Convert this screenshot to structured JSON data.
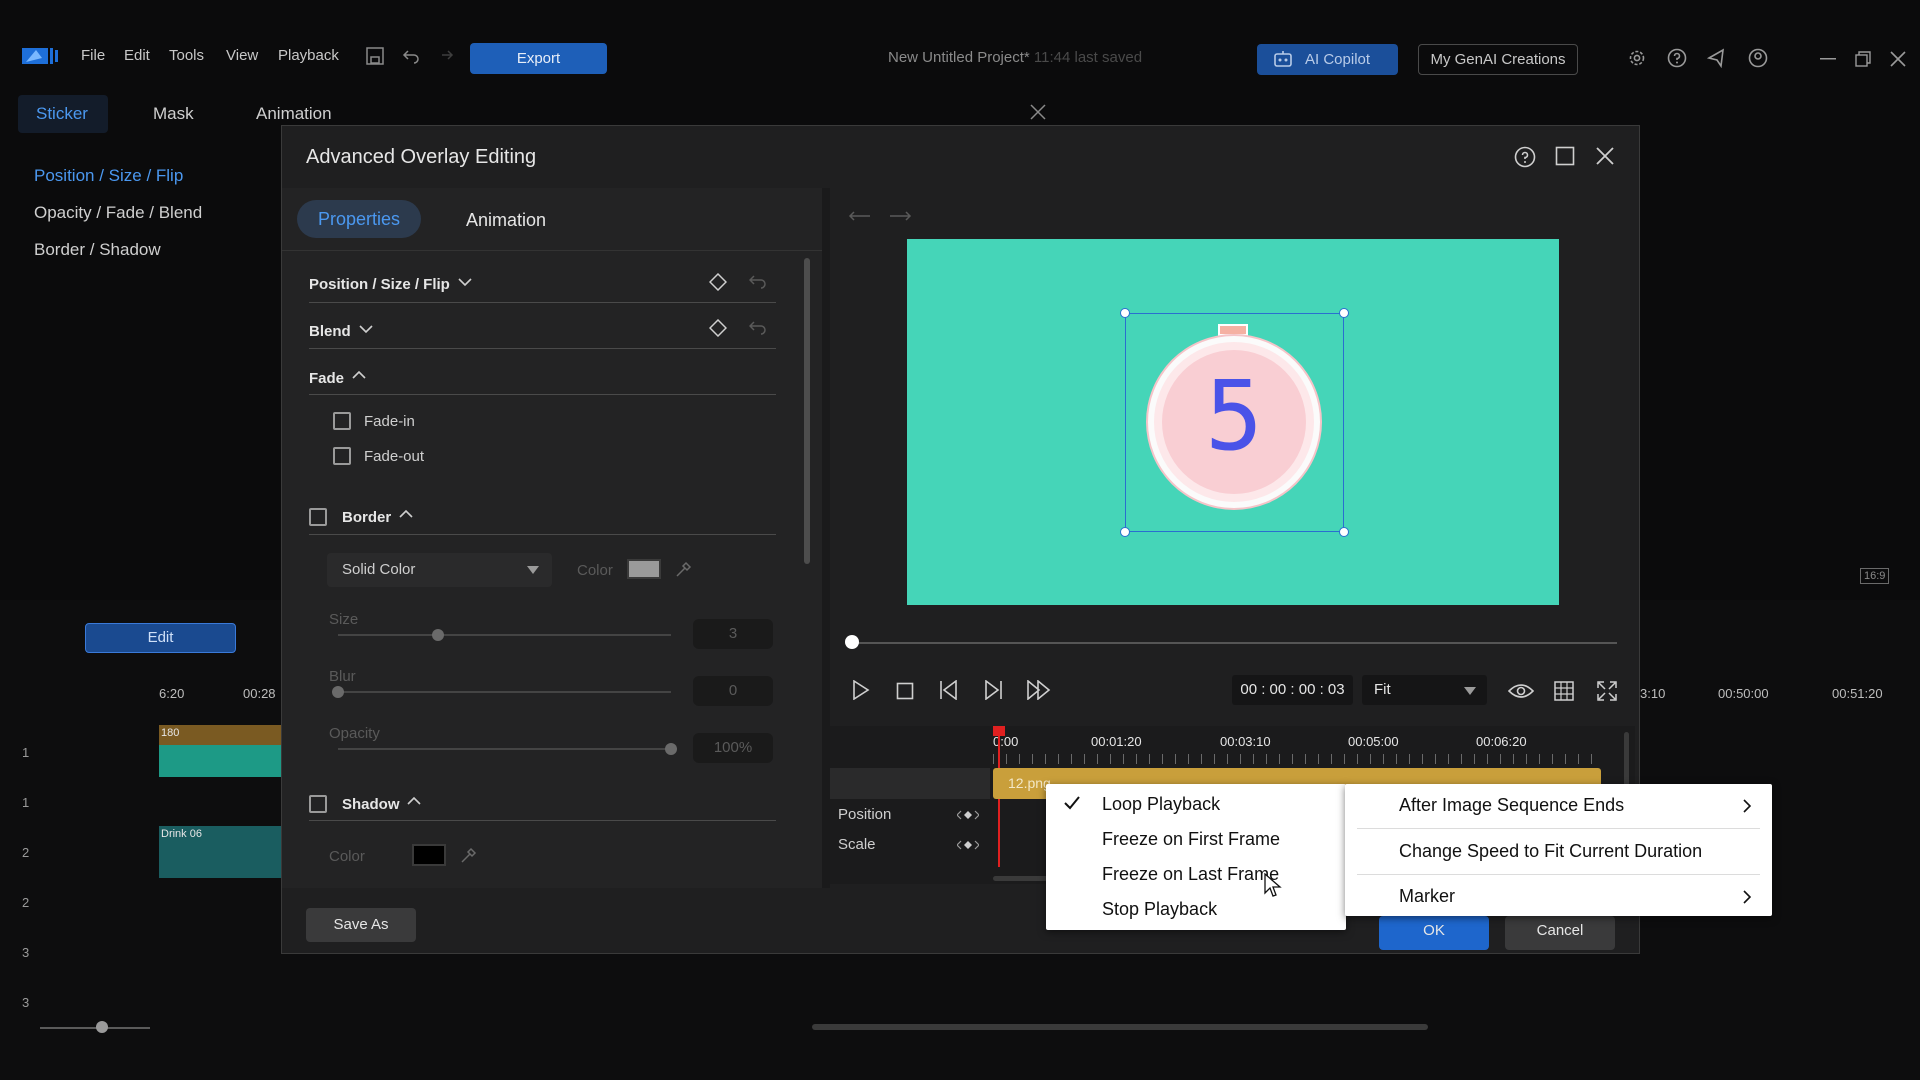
{
  "menubar": {
    "items": [
      "File",
      "Edit",
      "Tools",
      "View",
      "Playback"
    ],
    "export_label": "Export",
    "project_title": "New Untitled Project*",
    "saved_status": "11:44 last saved",
    "copilot_label": "AI Copilot",
    "genai_label": "My GenAI Creations"
  },
  "left_panel": {
    "tabs": [
      "Sticker",
      "Mask",
      "Animation"
    ],
    "items": [
      "Position / Size / Flip",
      "Opacity / Fade / Blend",
      "Border / Shadow"
    ]
  },
  "bg_timeline": {
    "edit_label": "Edit",
    "ruler_left": [
      "6:20",
      "00:28"
    ],
    "ruler_right": [
      "3:10",
      "00:50:00",
      "00:51:20"
    ],
    "aspect": "16:9",
    "track_numbers": [
      "1",
      "1",
      "2",
      "2",
      "3",
      "3"
    ],
    "clip1_label": "180",
    "clip2_label": "Drink 06"
  },
  "dialog": {
    "title": "Advanced Overlay Editing",
    "tabs": {
      "properties": "Properties",
      "animation": "Animation"
    },
    "sections": {
      "position": "Position / Size / Flip",
      "blend": "Blend",
      "fade": "Fade",
      "fade_in": "Fade-in",
      "fade_out": "Fade-out",
      "border": "Border",
      "border_type": "Solid Color",
      "color_label": "Color",
      "size_label": "Size",
      "size_value": "3",
      "blur_label": "Blur",
      "blur_value": "0",
      "opacity_label": "Opacity",
      "opacity_value": "100%",
      "shadow": "Shadow",
      "shadow_color_label": "Color"
    },
    "sliders": {
      "size_level": 0.3,
      "blur_level": 0.0,
      "opacity_level": 1.0
    },
    "preview": {
      "background": "#45d5b8",
      "timer_digit": "5",
      "timecode": "00 : 00 : 00 : 03",
      "zoom": "Fit"
    },
    "inner_timeline": {
      "ruler": [
        "0:00",
        "00:01:20",
        "00:03:10",
        "00:05:00",
        "00:06:20"
      ],
      "clip_label": "12.png",
      "rows": [
        "Position",
        "Scale"
      ]
    },
    "save_as_label": "Save As",
    "ok_label": "OK",
    "cancel_label": "Cancel"
  },
  "context_menu": {
    "items": [
      {
        "label": "Loop Playback",
        "checked": true
      },
      {
        "label": "Freeze on First Frame",
        "checked": false
      },
      {
        "label": "Freeze on Last Frame",
        "checked": false
      },
      {
        "label": "Stop Playback",
        "checked": false
      }
    ],
    "submenu": [
      "After Image Sequence Ends",
      "Change Speed to Fit Current Duration",
      "Marker"
    ]
  },
  "colors": {
    "accent": "#4b98f0",
    "export_bg": "#1e5fb8",
    "clip": "#c99f3b",
    "preview_bg": "#45d5b8"
  }
}
